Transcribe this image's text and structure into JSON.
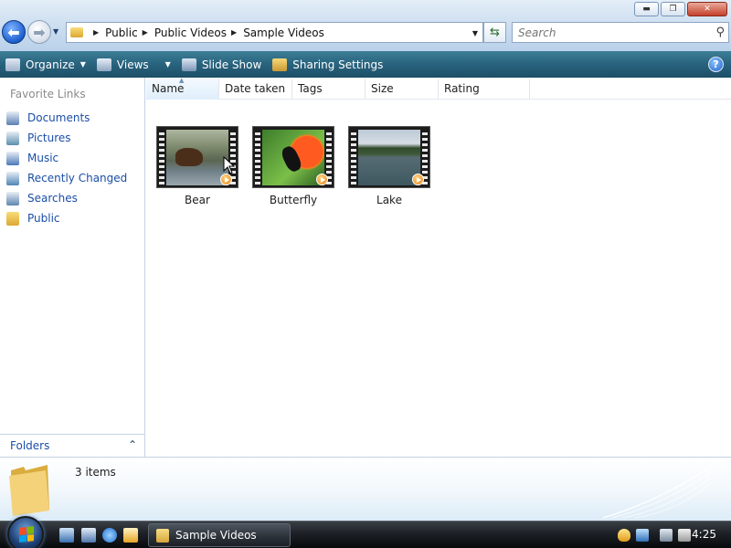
{
  "window": {
    "buttons": {
      "minimize": "▬",
      "maximize": "❐",
      "close": "✕"
    }
  },
  "address": {
    "crumbs": [
      "Public",
      "Public Videos",
      "Sample Videos"
    ],
    "separator": "▶",
    "dropdown": "▼"
  },
  "search": {
    "placeholder": "Search"
  },
  "toolbar": {
    "organize": "Organize",
    "views": "Views",
    "slideshow": "Slide Show",
    "sharing": "Sharing Settings",
    "help": "?"
  },
  "nav": {
    "favorites_header": "Favorite Links",
    "items": [
      {
        "label": "Documents",
        "icon": "documents-icon",
        "color": "#5b7fb3"
      },
      {
        "label": "Pictures",
        "icon": "pictures-icon",
        "color": "#5b8fb0"
      },
      {
        "label": "Music",
        "icon": "music-icon",
        "color": "#4b78b8"
      },
      {
        "label": "Recently Changed",
        "icon": "recent-icon",
        "color": "#4e85b5"
      },
      {
        "label": "Searches",
        "icon": "searches-icon",
        "color": "#5f86b0"
      },
      {
        "label": "Public",
        "icon": "public-folder-icon",
        "color": "#e7b945"
      }
    ],
    "folders_label": "Folders",
    "folders_chevron": "⌃"
  },
  "columns": [
    "Name",
    "Date taken",
    "Tags",
    "Size",
    "Rating"
  ],
  "files": [
    {
      "name": "Bear"
    },
    {
      "name": "Butterfly"
    },
    {
      "name": "Lake"
    }
  ],
  "details": {
    "count_text": "3 items"
  },
  "taskbar": {
    "task_label": "Sample Videos",
    "clock": "4:25"
  },
  "colors": {
    "accent": "#1b4ea7",
    "commandbar": "#2a6580",
    "taskbar": "#1d2127"
  }
}
